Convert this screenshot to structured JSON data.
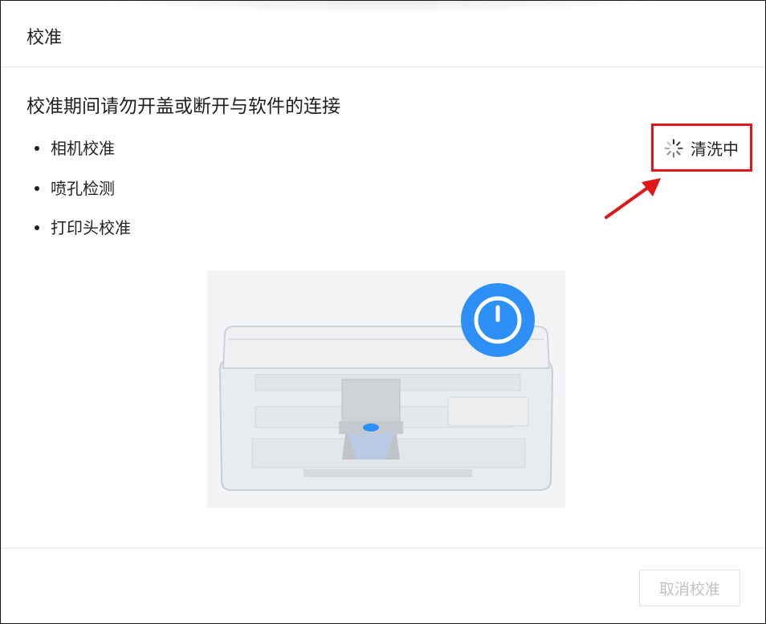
{
  "dialog": {
    "title": "校准",
    "warning": "校准期间请勿开盖或断开与软件的连接",
    "steps": [
      {
        "label": "相机校准"
      },
      {
        "label": "喷孔检测"
      },
      {
        "label": "打印头校准"
      }
    ],
    "status": {
      "label": "清洗中",
      "icon": "loading-spinner-icon"
    },
    "cancel_label": "取消校准"
  },
  "colors": {
    "highlight": "#e0161b",
    "accent": "#2e8ff7",
    "disabled_text": "#c2c2c2"
  }
}
